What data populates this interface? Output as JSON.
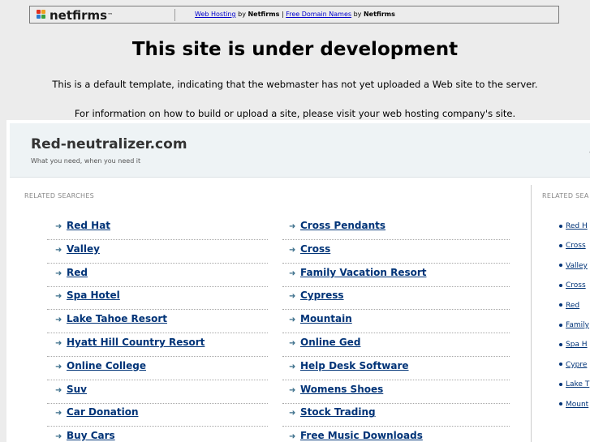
{
  "header": {
    "logo_text": "netfirms",
    "links": [
      {
        "text": "Web Hosting",
        "suffix": " by ",
        "brand": "Netfirms"
      },
      {
        "text": "Free Domain Names",
        "suffix": " by ",
        "brand": "Netfirms"
      }
    ],
    "divider": " | "
  },
  "main": {
    "title": "This site is under development",
    "info_line1": "This is a default template, indicating that the webmaster has not yet uploaded a Web site to the server.",
    "info_line2": "For information on how to build or upload a site, please visit your web hosting company's site."
  },
  "panel": {
    "domain": "Red-neutralizer.com",
    "tagline": "What you need, when you need it",
    "right_mark": "4",
    "related_label": "RELATED SEARCHES",
    "side_label": "RELATED SEA",
    "left_column": [
      "Red Hat",
      "Valley",
      "Red",
      "Spa Hotel",
      "Lake Tahoe Resort",
      "Hyatt Hill Country Resort",
      "Online College",
      "Suv",
      "Car Donation",
      "Buy Cars"
    ],
    "right_column": [
      "Cross Pendants",
      "Cross",
      "Family Vacation Resort",
      "Cypress",
      "Mountain",
      "Online Ged",
      "Help Desk Software",
      "Womens Shoes",
      "Stock Trading",
      "Free Music Downloads"
    ],
    "side_links": [
      "Red H",
      "Cross",
      "Valley",
      "Cross",
      "Red",
      "Family",
      "Spa H",
      "Cypre",
      "Lake T",
      "Mount"
    ]
  },
  "colors": {
    "link": "#003377",
    "bar": "#eef3f5",
    "page_bg": "#ececec"
  }
}
